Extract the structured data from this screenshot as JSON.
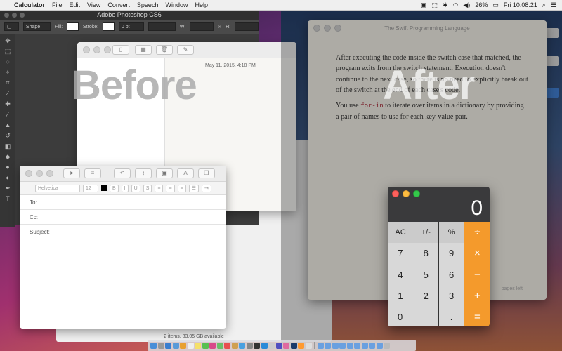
{
  "menubar": {
    "apple": "",
    "app": "Calculator",
    "menus": [
      "File",
      "Edit",
      "View",
      "Convert",
      "Speech",
      "Window",
      "Help"
    ],
    "battery": "26%",
    "clock": "Fri 10:08:21"
  },
  "photoshop": {
    "title": "Adobe Photoshop CS6",
    "shape_mode": "Shape",
    "fill_label": "Fill:",
    "stroke_label": "Stroke:",
    "stroke_width": "0 pt",
    "w_label": "W:",
    "h_label": "H:"
  },
  "notes": {
    "date": "May 11, 2015, 4:18 PM"
  },
  "mail": {
    "font": "Helvetica",
    "size": "12",
    "to_label": "To:",
    "cc_label": "Cc:",
    "subject_label": "Subject:"
  },
  "finder": {
    "status": "2 items, 83.05 GB available"
  },
  "book": {
    "title": "The Swift Programming Language",
    "para1": "After executing the code inside the switch case that matched, the program exits from the switch statement. Execution doesn't continue to the next case, so there is no need to explicitly break out of the switch at the end of each case's code.",
    "para2_before": "You use ",
    "para2_code": "for-in",
    "para2_after": " to iterate over items in a dictionary by providing a pair of names to use for each key-value pair.",
    "page_info": "pages left"
  },
  "calculator": {
    "display": "0",
    "keys": [
      "AC",
      "+/-",
      "%",
      "÷",
      "7",
      "8",
      "9",
      "×",
      "4",
      "5",
      "6",
      "−",
      "1",
      "2",
      "3",
      "+",
      "0",
      ".",
      "="
    ]
  },
  "overlay": {
    "before": "Before",
    "after": "After"
  }
}
